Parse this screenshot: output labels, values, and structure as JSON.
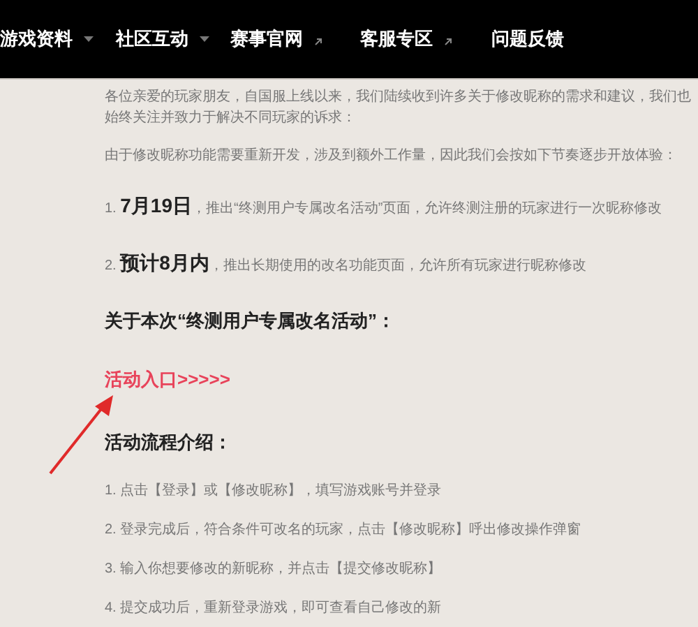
{
  "nav": [
    {
      "label": "游戏资料",
      "kind": "dropdown"
    },
    {
      "label": "社区互动",
      "kind": "dropdown"
    },
    {
      "label": "赛事官网",
      "kind": "external"
    },
    {
      "label": "客服专区",
      "kind": "external"
    },
    {
      "label": "问题反馈",
      "kind": "plain"
    }
  ],
  "intro": [
    "各位亲爱的玩家朋友，自国服上线以来，我们陆续收到许多关于修改昵称的需求和建议，我们也始终关注并致力于解决不同玩家的诉求：",
    "由于修改昵称功能需要重新开发，涉及到额外工作量，因此我们会按如下节奏逐步开放体验："
  ],
  "schedule": [
    {
      "number": "1.",
      "date": "7月19日",
      "text": "，推出“终测用户专属改名活动”页面，允许终测注册的玩家进行一次昵称修改"
    },
    {
      "number": "2.",
      "date": "预计8月内",
      "text": "，推出长期使用的改名功能页面，允许所有玩家进行昵称修改"
    }
  ],
  "activity_heading": "关于本次“终测用户专属改名活动”：",
  "activity_link": "活动入口>>>>>",
  "flow_heading": "活动流程介绍：",
  "steps": [
    "1. 点击【登录】或【修改昵称】，填写游戏账号并登录",
    "2. 登录完成后，符合条件可改名的玩家，点击【修改昵称】呼出修改操作弹窗",
    "3. 输入你想要修改的新昵称，并点击【提交修改昵称】",
    "4. 提交成功后，重新登录游戏，即可查看自己修改的新"
  ]
}
